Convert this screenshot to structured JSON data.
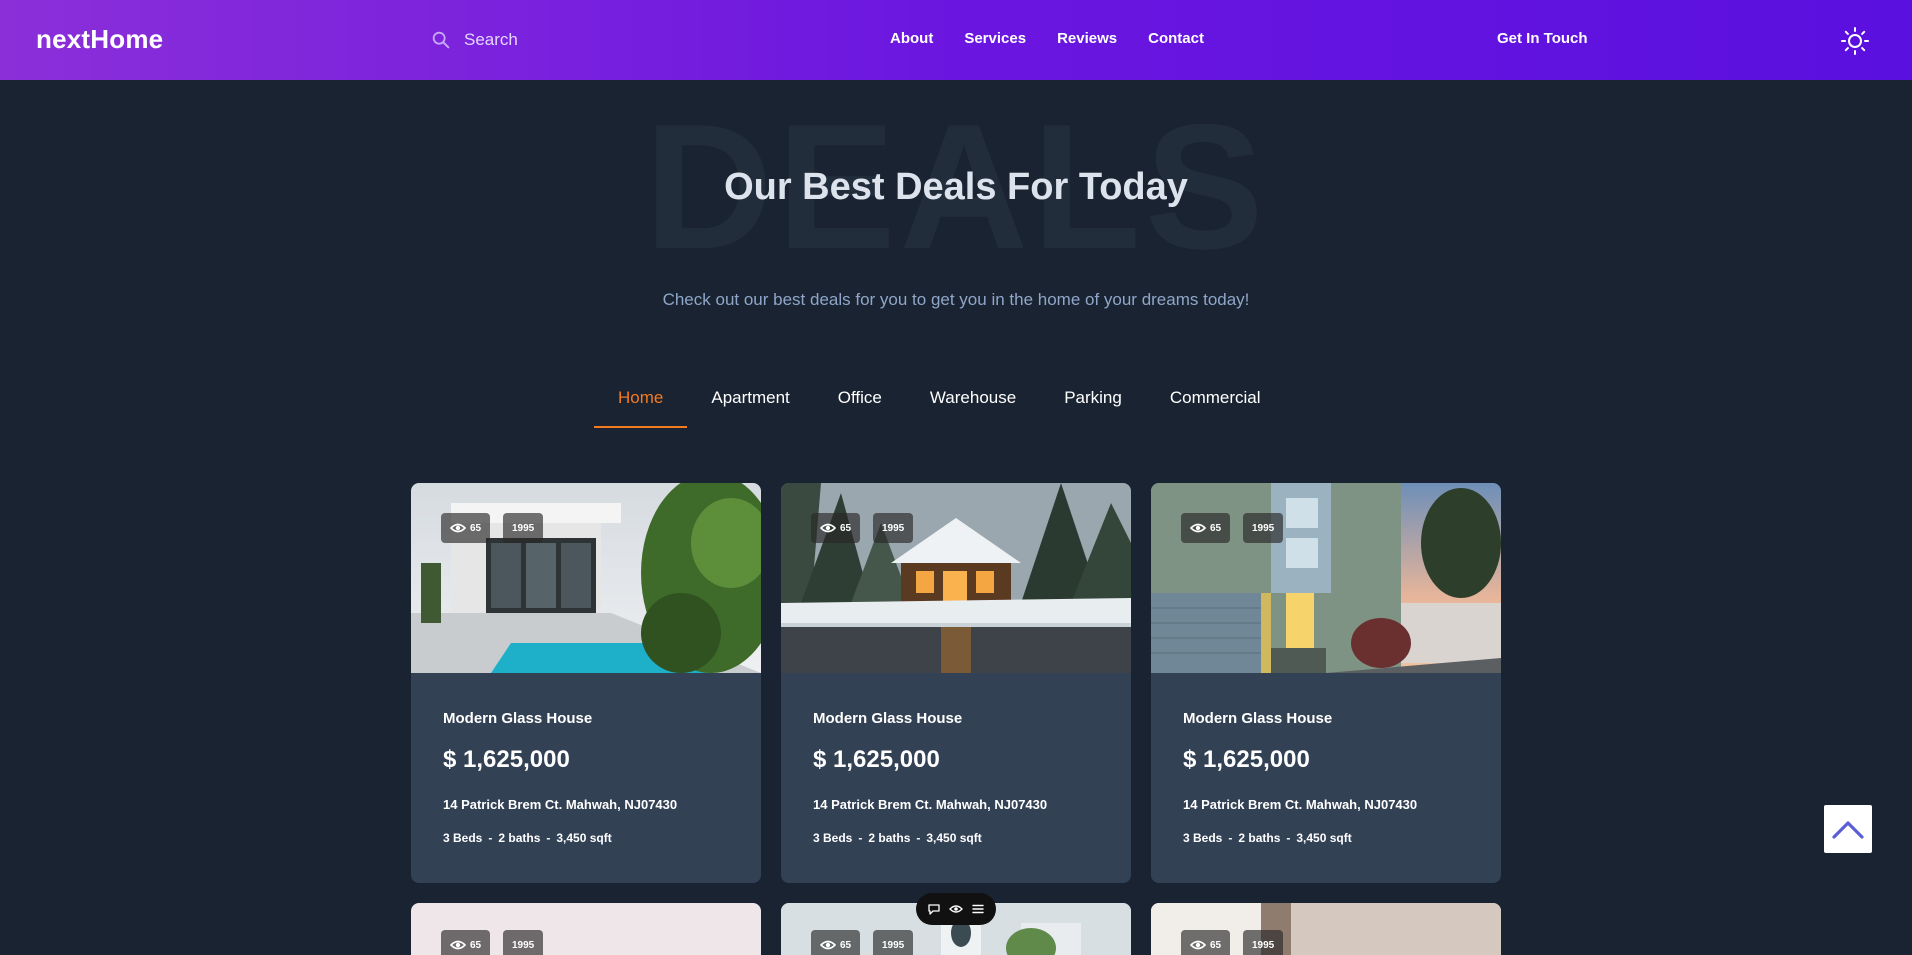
{
  "header": {
    "logo": "nextHome",
    "search_placeholder": "Search",
    "nav": [
      "About",
      "Services",
      "Reviews",
      "Contact"
    ],
    "cta": "Get In Touch",
    "theme_icon": "sun-icon"
  },
  "hero": {
    "background_word": "DEALS",
    "title": "Our Best Deals For Today",
    "subtitle": "Check out our best deals for you to get you in the home of your dreams today!"
  },
  "tabs": [
    {
      "label": "Home",
      "active": true
    },
    {
      "label": "Apartment",
      "active": false
    },
    {
      "label": "Office",
      "active": false
    },
    {
      "label": "Warehouse",
      "active": false
    },
    {
      "label": "Parking",
      "active": false
    },
    {
      "label": "Commercial",
      "active": false
    }
  ],
  "cards": [
    {
      "views": "65",
      "year": "1995",
      "title": "Modern Glass House",
      "price": "$ 1,625,000",
      "address": "14 Patrick Brem Ct. Mahwah, NJ07430",
      "beds": "3 Beds",
      "baths": "2 baths",
      "area": "3,450 sqft"
    },
    {
      "views": "65",
      "year": "1995",
      "title": "Modern Glass House",
      "price": "$ 1,625,000",
      "address": "14 Patrick Brem Ct. Mahwah, NJ07430",
      "beds": "3 Beds",
      "baths": "2 baths",
      "area": "3,450 sqft"
    },
    {
      "views": "65",
      "year": "1995",
      "title": "Modern Glass House",
      "price": "$ 1,625,000",
      "address": "14 Patrick Brem Ct. Mahwah, NJ07430",
      "beds": "3 Beds",
      "baths": "2 baths",
      "area": "3,450 sqft"
    }
  ],
  "next_row": [
    {
      "views": "65",
      "year": "1995"
    },
    {
      "views": "65",
      "year": "1995"
    },
    {
      "views": "65",
      "year": "1995"
    }
  ],
  "spec_separator": "-",
  "colors": {
    "header_start": "#8b2fd9",
    "header_end": "#5a10df",
    "background": "#1a2331",
    "card": "#334155",
    "accent": "#f47a20"
  }
}
